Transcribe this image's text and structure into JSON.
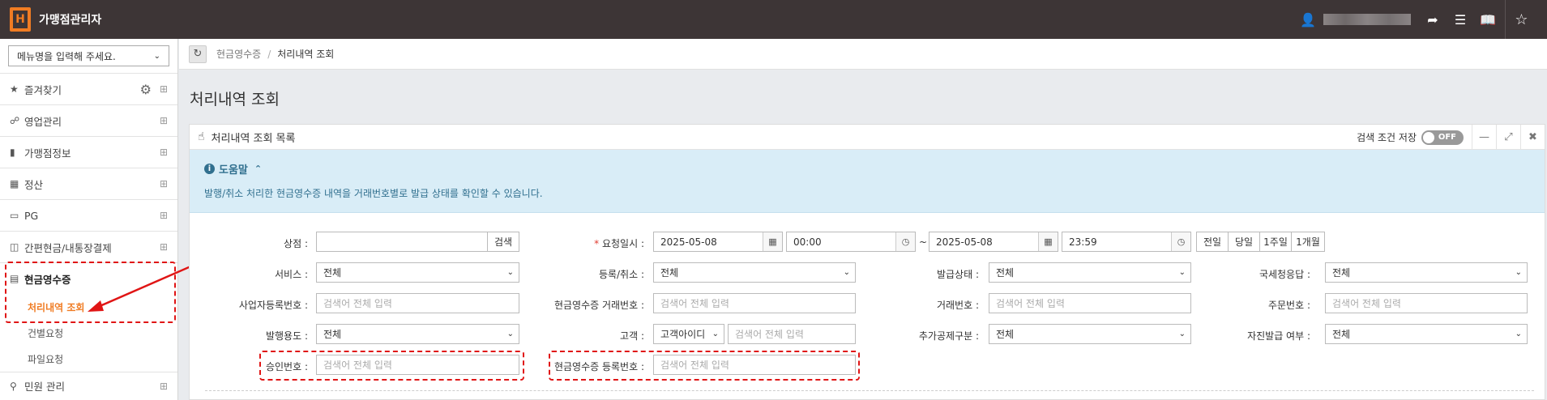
{
  "app": {
    "logo_letter": "H",
    "title": "가맹점관리자"
  },
  "topbar": {
    "user_icon": "user-icon",
    "logout_icon": "logout-icon",
    "menu_icon": "hamburger-icon",
    "book_icon": "book-icon",
    "star_icon": "star-icon"
  },
  "sidebar": {
    "menu_select": "메뉴명을 입력해 주세요.",
    "items": [
      {
        "label": "즐겨찾기",
        "icon": "star-icon"
      },
      {
        "label": "영업관리",
        "icon": "handshake-icon"
      },
      {
        "label": "가맹점정보",
        "icon": "building-icon"
      },
      {
        "label": "정산",
        "icon": "calculator-icon"
      },
      {
        "label": "PG",
        "icon": "credit-card-icon"
      },
      {
        "label": "간편현금/내통장결제",
        "icon": "cash-icon"
      },
      {
        "label": "현금영수증",
        "icon": "receipt-icon"
      },
      {
        "label": "민원 관리",
        "icon": "search-icon"
      }
    ],
    "sub_items": [
      "처리내역 조회",
      "건별요청",
      "파일요청"
    ]
  },
  "breadcrumb": {
    "parent": "현금영수증",
    "separator": "/",
    "current": "처리내역 조회"
  },
  "page_title": "처리내역 조회",
  "panel": {
    "title": "처리내역 조회 목록",
    "save_label": "검색 조건 저장",
    "toggle_text": "OFF",
    "help_title": "도움말",
    "help_text": "발행/취소 처리한 현금영수증 내역을 거래번호별로 발급 상태를 확인할 수 있습니다."
  },
  "form": {
    "store_label": "상점 :",
    "search_btn": "검색",
    "req_mark": "*",
    "request_date_label": "요청일시 :",
    "start_date": "2025-05-08",
    "start_time": "00:00",
    "tilde": "~",
    "end_date": "2025-05-08",
    "end_time": "23:59",
    "quick": [
      "전일",
      "당일",
      "1주일",
      "1개월"
    ],
    "service_label": "서비스 :",
    "service_value": "전체",
    "reg_cancel_label": "등록/취소 :",
    "reg_cancel_value": "전체",
    "issue_status_label": "발급상태 :",
    "issue_status_value": "전체",
    "nts_label": "국세청응답 :",
    "nts_value": "전체",
    "bizno_label": "사업자등록번호 :",
    "receipt_tx_label": "현금영수증 거래번호 :",
    "txno_label": "거래번호 :",
    "orderno_label": "주문번호 :",
    "placeholder": "검색어 전체 입력",
    "purpose_label": "발행용도 :",
    "purpose_value": "전체",
    "customer_label": "고객 :",
    "customer_type": "고객아이디",
    "deduction_label": "추가공제구분 :",
    "deduction_value": "전체",
    "self_issue_label": "자진발급 여부 :",
    "self_issue_value": "전체",
    "approval_label": "승인번호 :",
    "receipt_reg_label": "현금영수증 등록번호 :"
  }
}
